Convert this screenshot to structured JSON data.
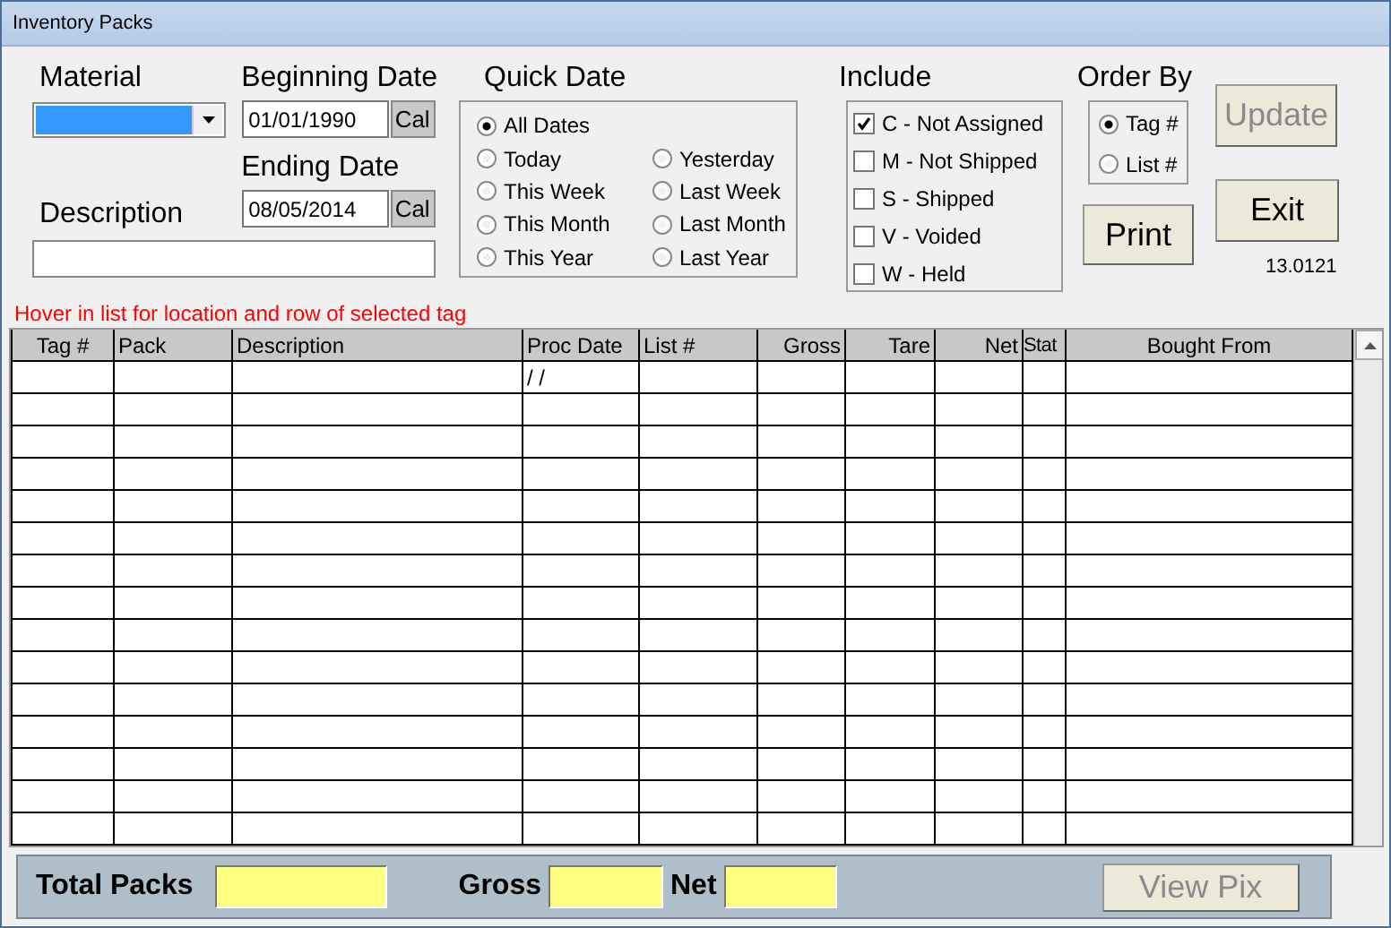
{
  "window": {
    "title": "Inventory Packs"
  },
  "material": {
    "label": "Material",
    "selected": true
  },
  "dates": {
    "beginning_label": "Beginning Date",
    "beginning_value": "01/01/1990",
    "ending_label": "Ending Date",
    "ending_value": "08/05/2014",
    "cal_buttons": [
      "Cal",
      "Cal"
    ]
  },
  "description": {
    "label": "Description"
  },
  "quick_date": {
    "label": "Quick Date",
    "options": [
      {
        "label": "All Dates",
        "selected": true
      },
      {
        "label": "Today",
        "selected": false
      },
      {
        "label": "Yesterday",
        "selected": false
      },
      {
        "label": "This Week",
        "selected": false
      },
      {
        "label": "Last Week",
        "selected": false
      },
      {
        "label": "This Month",
        "selected": false
      },
      {
        "label": "Last Month",
        "selected": false
      },
      {
        "label": "This Year",
        "selected": false
      },
      {
        "label": "Last Year",
        "selected": false
      }
    ]
  },
  "include": {
    "label": "Include",
    "options": [
      {
        "label": "C - Not Assigned",
        "checked": true
      },
      {
        "label": "M - Not Shipped",
        "checked": false
      },
      {
        "label": "S - Shipped",
        "checked": false
      },
      {
        "label": "V - Voided",
        "checked": false
      },
      {
        "label": "W - Held",
        "checked": false
      }
    ]
  },
  "order_by": {
    "label": "Order By",
    "options": [
      {
        "label": "Tag #",
        "selected": true
      },
      {
        "label": "List #",
        "selected": false
      }
    ]
  },
  "buttons": [
    {
      "label": "Update",
      "disabled": true
    },
    {
      "label": "Print",
      "disabled": false
    },
    {
      "label": "Exit",
      "disabled": false
    }
  ],
  "version": "13.0121",
  "hint": "Hover in list for location and row of selected tag",
  "table": {
    "columns": [
      "Tag #",
      "Pack",
      "Description",
      "Proc Date",
      "List #",
      "Gross",
      "Tare",
      "Net",
      "Stat",
      "Bought From"
    ],
    "rows": [
      {
        "proc_date": "/ /"
      }
    ]
  },
  "totals": {
    "total_packs_label": "Total Packs",
    "gross_label": "Gross",
    "net_label": "Net",
    "view_pix": {
      "label": "View Pix",
      "disabled": true
    }
  }
}
